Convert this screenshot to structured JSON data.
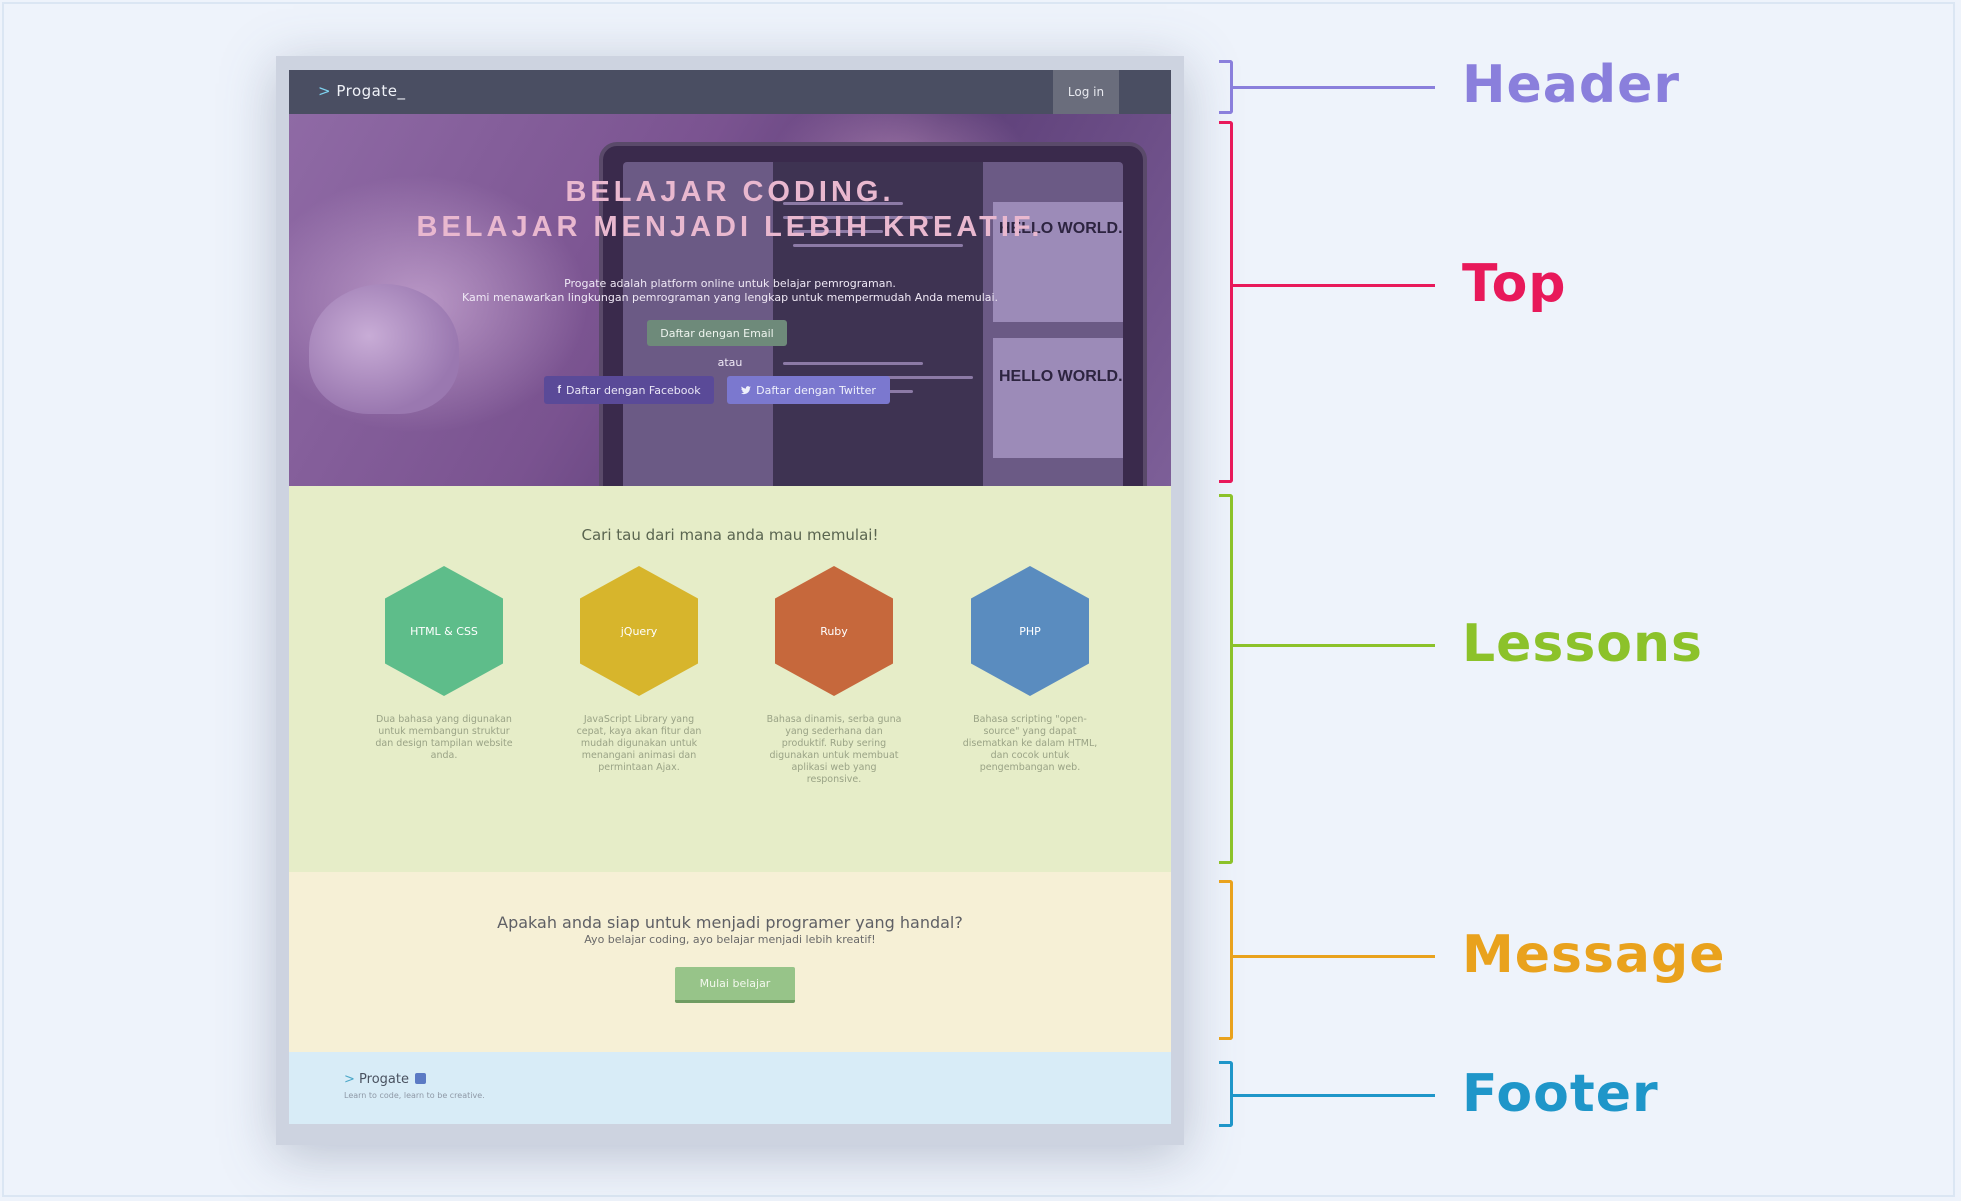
{
  "colors": {
    "header": "#8a7fdc",
    "top": "#e8195a",
    "lessons": "#8cc22a",
    "message": "#e9a21d",
    "footer": "#1f96c9"
  },
  "mockup": {
    "header": {
      "logo_chevron": ">",
      "logo_text": "Progate_",
      "login_label": "Log in"
    },
    "top": {
      "title_line1": "BELAJAR CODING.",
      "title_line2": "BELAJAR MENJADI LEBIH KREATIF.",
      "subtitle_line1": "Progate adalah platform online untuk belajar pemrograman.",
      "subtitle_line2": "Kami menawarkan lingkungan pemrograman yang lengkap untuk mempermudah Anda memulai.",
      "email_button": "Daftar dengan Email",
      "or_text": "atau",
      "facebook_button": "Daftar dengan Facebook",
      "twitter_button": "Daftar dengan Twitter",
      "screen_text_1": "HELLO WORLD.",
      "screen_text_2": "HELLO WORLD."
    },
    "lessons": {
      "title": "Cari tau dari mana anda mau memulai!",
      "items": [
        {
          "name": "HTML & CSS",
          "color": "#5ebd8a",
          "desc": "Dua bahasa yang digunakan untuk membangun struktur dan design tampilan website anda."
        },
        {
          "name": "jQuery",
          "color": "#d7b52c",
          "desc": "JavaScript Library yang cepat, kaya akan fitur dan mudah digunakan untuk menangani animasi dan permintaan Ajax."
        },
        {
          "name": "Ruby",
          "color": "#c6683c",
          "desc": "Bahasa dinamis, serba guna yang sederhana dan produktif. Ruby sering digunakan untuk membuat aplikasi web yang responsive."
        },
        {
          "name": "PHP",
          "color": "#5a8cbf",
          "desc": "Bahasa scripting \"open-source\" yang dapat disematkan ke dalam HTML, dan cocok untuk pengembangan web."
        }
      ]
    },
    "message": {
      "title": "Apakah anda siap untuk menjadi programer yang handal?",
      "subtitle": "Ayo belajar coding, ayo belajar menjadi lebih kreatif!",
      "button": "Mulai belajar"
    },
    "footer": {
      "logo_chevron": ">",
      "logo_text": "Progate",
      "tagline": "Learn to code, learn to be creative."
    }
  },
  "annotations": [
    {
      "key": "header",
      "label": "Header"
    },
    {
      "key": "top",
      "label": "Top"
    },
    {
      "key": "lessons",
      "label": "Lessons"
    },
    {
      "key": "message",
      "label": "Message"
    },
    {
      "key": "footer",
      "label": "Footer"
    }
  ]
}
